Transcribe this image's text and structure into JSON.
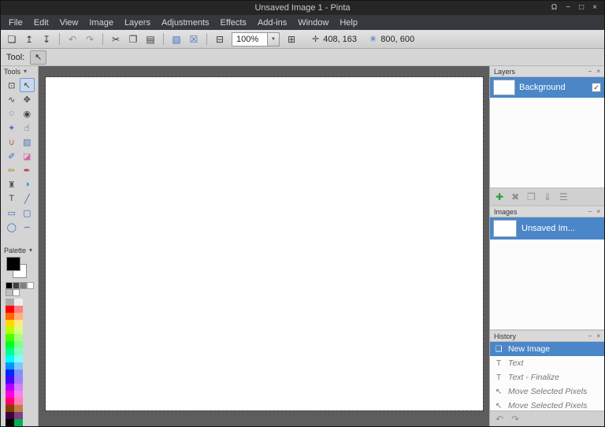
{
  "window": {
    "title": "Unsaved Image 1 - Pinta",
    "controls": [
      {
        "name": "notification-bell",
        "glyph": "Ω"
      },
      {
        "name": "minimize",
        "glyph": "−"
      },
      {
        "name": "maximize",
        "glyph": "□"
      },
      {
        "name": "close",
        "glyph": "×"
      }
    ]
  },
  "menu": {
    "items": [
      "File",
      "Edit",
      "View",
      "Image",
      "Layers",
      "Adjustments",
      "Effects",
      "Add-ins",
      "Window",
      "Help"
    ]
  },
  "toolbar": {
    "zoom_value": "100%",
    "dropdown_arrow_glyph": "▼",
    "items": [
      {
        "t": "btn",
        "name": "new-image-button",
        "glyph": "❏"
      },
      {
        "t": "btn",
        "name": "open-image-button",
        "glyph": "↥"
      },
      {
        "t": "btn",
        "name": "save-button",
        "glyph": "↧"
      },
      {
        "t": "sep"
      },
      {
        "t": "btn",
        "name": "undo-button",
        "glyph": "↶",
        "dim": true
      },
      {
        "t": "btn",
        "name": "redo-button",
        "glyph": "↷",
        "dim": true
      },
      {
        "t": "sep"
      },
      {
        "t": "btn",
        "name": "cut-button",
        "glyph": "✂"
      },
      {
        "t": "btn",
        "name": "copy-button",
        "glyph": "❐"
      },
      {
        "t": "btn",
        "name": "paste-button",
        "glyph": "▤"
      },
      {
        "t": "sep"
      },
      {
        "t": "btn",
        "name": "crop-to-selection-button",
        "glyph": "▧",
        "color": "#3f6fbf"
      },
      {
        "t": "btn",
        "name": "deselect-all-button",
        "glyph": "☒",
        "color": "#3f6fbf"
      },
      {
        "t": "sep"
      },
      {
        "t": "btn",
        "name": "zoom-out-button",
        "glyph": "⊟"
      },
      {
        "t": "zoom"
      },
      {
        "t": "btn",
        "name": "zoom-in-button",
        "glyph": "⊞"
      },
      {
        "t": "coords",
        "name": "cursor-position",
        "icon": "✛",
        "icon_name": "cursor-position-icon",
        "value": "408, 163"
      },
      {
        "t": "coords",
        "name": "selection-size",
        "icon": "✳",
        "icon_name": "selection-size-icon",
        "icon_color": "#4466cc",
        "value": "800, 600"
      }
    ]
  },
  "tool_options": {
    "label": "Tool:",
    "current_tool": "Move Selection",
    "current_tool_glyph": "↖"
  },
  "icons": {
    "collapse": "▾",
    "check": "✓"
  },
  "dock_header_buttons": [
    {
      "name": "minimize-panel",
      "glyph": "−"
    },
    {
      "name": "close-panel",
      "glyph": "×"
    }
  ],
  "tools_panel": {
    "title": "Tools",
    "tools": [
      {
        "name": "rectangle-select",
        "glyph": "⊡"
      },
      {
        "name": "move-selection",
        "glyph": "↖",
        "active": true
      },
      {
        "name": "lasso-select",
        "glyph": "∿"
      },
      {
        "name": "move-selected",
        "glyph": "✥"
      },
      {
        "name": "ellipse-select",
        "glyph": "◌"
      },
      {
        "name": "zoom",
        "glyph": "◉"
      },
      {
        "name": "magic-wand",
        "glyph": "✦",
        "color": "#7a5cc0"
      },
      {
        "name": "pan",
        "glyph": "☝"
      },
      {
        "name": "paint-bucket",
        "glyph": "∪",
        "color": "#b06a2a"
      },
      {
        "name": "gradient",
        "glyph": "▨",
        "color": "#4a7ab5"
      },
      {
        "name": "paintbrush",
        "glyph": "✐",
        "color": "#356ac0"
      },
      {
        "name": "eraser",
        "glyph": "◪",
        "color": "#d06aa0"
      },
      {
        "name": "pencil",
        "glyph": "✏",
        "color": "#b08a2a"
      },
      {
        "name": "color-picker",
        "glyph": "✒",
        "color": "#c03a3a"
      },
      {
        "name": "clone-stamp",
        "glyph": "♜",
        "color": "#555555"
      },
      {
        "name": "recolor",
        "glyph": "◑",
        "color": "#3a8ac0"
      },
      {
        "name": "text",
        "glyph": "T"
      },
      {
        "name": "line-curve",
        "glyph": "╱",
        "color": "#3a6ac0"
      },
      {
        "name": "rectangle",
        "glyph": "▭",
        "color": "#3a6ac0"
      },
      {
        "name": "rounded-rectangle",
        "glyph": "▢",
        "color": "#3a6ac0"
      },
      {
        "name": "ellipse",
        "glyph": "◯",
        "color": "#3a6ac0"
      },
      {
        "name": "freeform-shape",
        "glyph": "∽",
        "color": "#3a6ac0"
      }
    ]
  },
  "palette_panel": {
    "title": "Palette",
    "primary_color": "#000000",
    "secondary_color": "#ffffff",
    "recent_colors": [
      "#000000",
      "#404040",
      "#808080",
      "#ffffff",
      "#bfbfbf",
      "#ffffff"
    ],
    "palette_rows": [
      [
        "#aaaaaa",
        "#eeeeee"
      ],
      [
        "#ff0000",
        "#ff7f7f"
      ],
      [
        "#ff6a00",
        "#ffb27f"
      ],
      [
        "#ffd800",
        "#ffe97f"
      ],
      [
        "#b6ff00",
        "#daff7f"
      ],
      [
        "#4cff00",
        "#a5ff7f"
      ],
      [
        "#00ff21",
        "#7fff8e"
      ],
      [
        "#00ff90",
        "#7fffc5"
      ],
      [
        "#00ffff",
        "#7fffff"
      ],
      [
        "#0094ff",
        "#7fc9ff"
      ],
      [
        "#0026ff",
        "#7f92ff"
      ],
      [
        "#4800ff",
        "#a17fff"
      ],
      [
        "#b200ff",
        "#d67fff"
      ],
      [
        "#ff00dc",
        "#ff7fed"
      ],
      [
        "#ff006e",
        "#ff7fb6"
      ],
      [
        "#804000",
        "#c08040"
      ],
      [
        "#400040",
        "#804080"
      ],
      [
        "#000000",
        "#00b050"
      ]
    ]
  },
  "layers_panel": {
    "title": "Layers",
    "layers": [
      {
        "name": "Background",
        "visible": true,
        "selected": true
      }
    ],
    "buttons": [
      {
        "name": "add-layer-button",
        "glyph": "✚",
        "green": true
      },
      {
        "name": "delete-layer-button",
        "glyph": "✖"
      },
      {
        "name": "duplicate-layer-button",
        "glyph": "❐"
      },
      {
        "name": "merge-layer-down-button",
        "glyph": "⇓"
      },
      {
        "name": "layer-properties-button",
        "glyph": "☰"
      }
    ]
  },
  "images_panel": {
    "title": "Images",
    "images": [
      {
        "name": "Unsaved Im...",
        "selected": true
      }
    ]
  },
  "history_panel": {
    "title": "History",
    "entries": [
      {
        "label": "New Image",
        "glyph": "❏",
        "state": "current"
      },
      {
        "label": "Text",
        "glyph": "T",
        "state": "undone"
      },
      {
        "label": "Text - Finalize",
        "glyph": "T",
        "state": "undone"
      },
      {
        "label": "Move Selected Pixels",
        "glyph": "↖",
        "state": "undone"
      },
      {
        "label": "Move Selected Pixels",
        "glyph": "↖",
        "state": "undone"
      }
    ],
    "footer": [
      {
        "name": "history-undo-button",
        "glyph": "↶"
      },
      {
        "name": "history-redo-button",
        "glyph": "↷"
      }
    ]
  },
  "colors": {
    "accent": "#4a86c8",
    "titlebar": "#262626",
    "menubar": "#35393e",
    "canvas_background": "#5d5d5d"
  }
}
